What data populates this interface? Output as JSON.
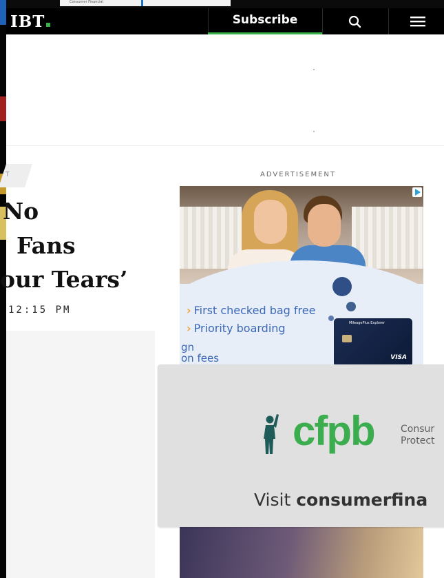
{
  "top_sliver": {
    "thumb_text": "Consumer Financial"
  },
  "header": {
    "logo": "IBT",
    "subscribe_label": "Subscribe",
    "search_icon": "search-icon",
    "menu_icon": "hamburger-menu-icon",
    "accent_color": "#37b34a"
  },
  "article": {
    "category": "T",
    "headline_lines": [
      "No",
      "Fans",
      "our Tears’"
    ],
    "timestamp": "12:15 PM"
  },
  "ad": {
    "label": "ADVERTISEMENT",
    "line_1": "First checked bag free",
    "line_2": "Priority boarding",
    "fees_1": "gn",
    "fees_2": "on fees",
    "card_title": "MileagePlus Explorer",
    "card_brand": "VISA",
    "adchoices_icon": "adchoices-play-icon"
  },
  "cfpb": {
    "logo": "cfpb",
    "name_line_1": "Consur",
    "name_line_2": "Protect",
    "cta_prefix": "Visit ",
    "cta_domain": "consumerfina",
    "brand_color": "#3cad4e"
  }
}
